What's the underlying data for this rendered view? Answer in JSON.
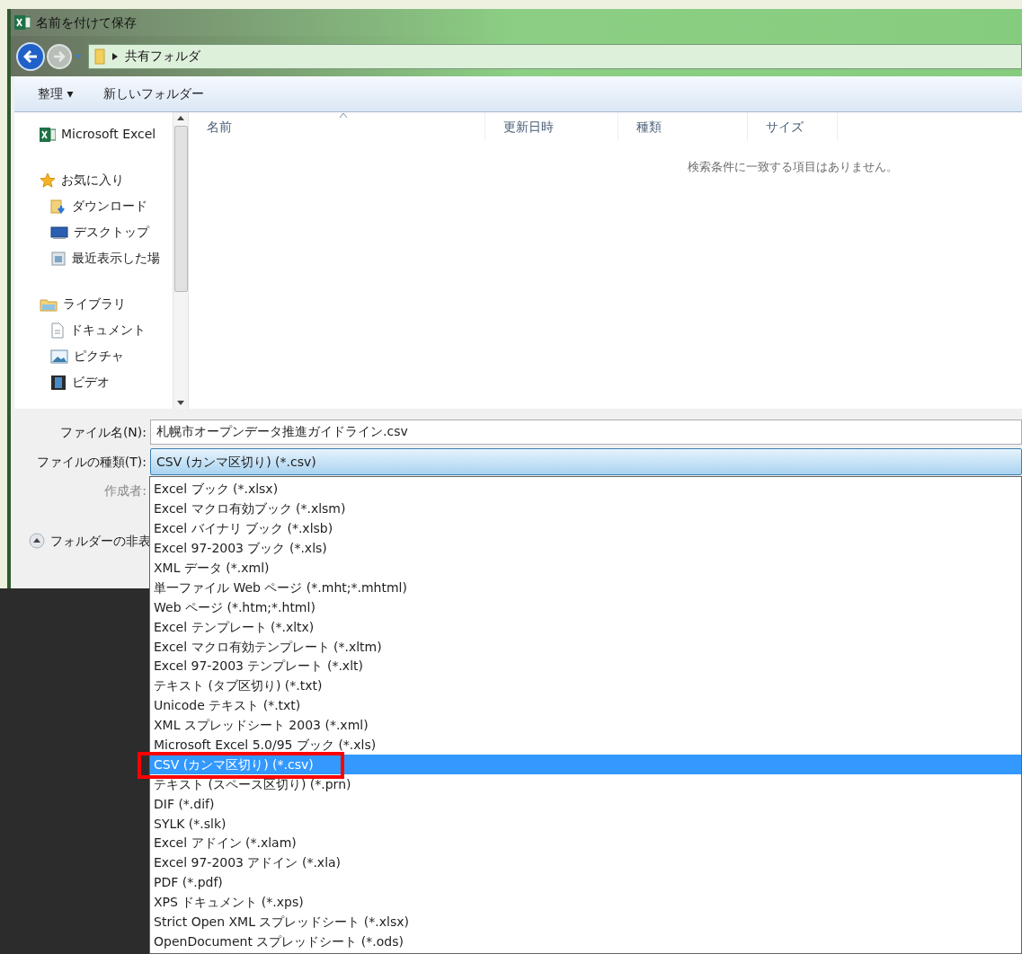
{
  "window": {
    "title": "名前を付けて保存"
  },
  "address_bar": {
    "path": "共有フォルダ"
  },
  "toolbar": {
    "organize": "整理 ▾",
    "new_folder": "新しいフォルダー"
  },
  "nav_pane": [
    {
      "label": "Microsoft Excel",
      "kind": "excel"
    },
    {
      "label": "お気に入り",
      "kind": "star",
      "children": [
        {
          "label": "ダウンロード",
          "kind": "download"
        },
        {
          "label": "デスクトップ",
          "kind": "desktop"
        },
        {
          "label": "最近表示した場",
          "kind": "recent"
        }
      ]
    },
    {
      "label": "ライブラリ",
      "kind": "library",
      "children": [
        {
          "label": "ドキュメント",
          "kind": "document"
        },
        {
          "label": "ピクチャ",
          "kind": "picture"
        },
        {
          "label": "ビデオ",
          "kind": "video"
        }
      ]
    }
  ],
  "file_list": {
    "columns": [
      "名前",
      "更新日時",
      "種類",
      "サイズ"
    ],
    "empty_message": "検索条件に一致する項目はありません。"
  },
  "form": {
    "filename_label": "ファイル名(N):",
    "filename": "札幌市オープンデータ推進ガイドライン.csv",
    "filetype_label": "ファイルの種類(T):",
    "filetype": "CSV (カンマ区切り) (*.csv)",
    "author_label": "作成者:",
    "hide_folders": "フォルダーの非表"
  },
  "filetype_options": [
    {
      "label": "Excel ブック (*.xlsx)",
      "selected": false,
      "annotated": false
    },
    {
      "label": "Excel マクロ有効ブック (*.xlsm)",
      "selected": false,
      "annotated": false
    },
    {
      "label": "Excel バイナリ ブック (*.xlsb)",
      "selected": false,
      "annotated": false
    },
    {
      "label": "Excel 97-2003 ブック (*.xls)",
      "selected": false,
      "annotated": false
    },
    {
      "label": "XML データ (*.xml)",
      "selected": false,
      "annotated": false
    },
    {
      "label": "単一ファイル Web ページ (*.mht;*.mhtml)",
      "selected": false,
      "annotated": false
    },
    {
      "label": "Web ページ (*.htm;*.html)",
      "selected": false,
      "annotated": false
    },
    {
      "label": "Excel テンプレート (*.xltx)",
      "selected": false,
      "annotated": false
    },
    {
      "label": "Excel マクロ有効テンプレート (*.xltm)",
      "selected": false,
      "annotated": false
    },
    {
      "label": "Excel 97-2003 テンプレート (*.xlt)",
      "selected": false,
      "annotated": false
    },
    {
      "label": "テキスト (タブ区切り) (*.txt)",
      "selected": false,
      "annotated": false
    },
    {
      "label": "Unicode テキスト (*.txt)",
      "selected": false,
      "annotated": false
    },
    {
      "label": "XML スプレッドシート 2003 (*.xml)",
      "selected": false,
      "annotated": false
    },
    {
      "label": "Microsoft Excel 5.0/95 ブック (*.xls)",
      "selected": false,
      "annotated": false
    },
    {
      "label": "CSV (カンマ区切り) (*.csv)",
      "selected": true,
      "annotated": true
    },
    {
      "label": "テキスト (スペース区切り) (*.prn)",
      "selected": false,
      "annotated": false
    },
    {
      "label": "DIF (*.dif)",
      "selected": false,
      "annotated": false
    },
    {
      "label": "SYLK (*.slk)",
      "selected": false,
      "annotated": false
    },
    {
      "label": "Excel アドイン (*.xlam)",
      "selected": false,
      "annotated": false
    },
    {
      "label": "Excel 97-2003 アドイン (*.xla)",
      "selected": false,
      "annotated": false
    },
    {
      "label": "PDF (*.pdf)",
      "selected": false,
      "annotated": false
    },
    {
      "label": "XPS ドキュメント (*.xps)",
      "selected": false,
      "annotated": false
    },
    {
      "label": "Strict Open XML スプレッドシート (*.xlsx)",
      "selected": false,
      "annotated": false
    },
    {
      "label": "OpenDocument スプレッドシート (*.ods)",
      "selected": false,
      "annotated": false
    }
  ]
}
